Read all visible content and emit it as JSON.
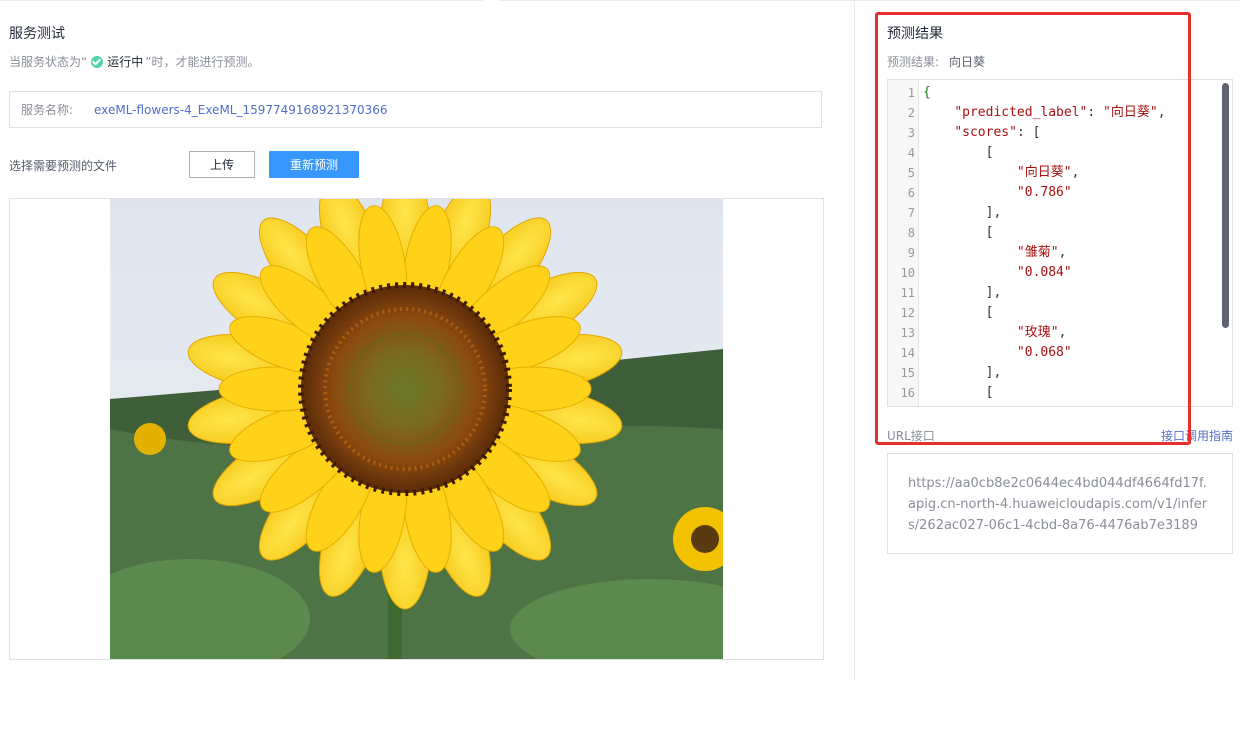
{
  "left": {
    "title": "服务测试",
    "hint_prefix": "当服务状态为“",
    "hint_status": "运行中",
    "hint_suffix": "”时，才能进行预测。",
    "service_label": "服务名称:",
    "service_value": "exeML-flowers-4_ExeML_1597749168921370366",
    "file_label": "选择需要预测的文件",
    "upload_label": "上传",
    "repredict_label": "重新预测",
    "image_icon": "sunflower-photo"
  },
  "right": {
    "title": "预测结果",
    "result_label": "预测结果:",
    "result_value": "向日葵",
    "line_numbers": [
      "1",
      "2",
      "3",
      "4",
      "5",
      "6",
      "7",
      "8",
      "9",
      "10",
      "11",
      "12",
      "13",
      "14",
      "15",
      "16"
    ],
    "code_lines": [
      "{",
      "    \"predicted_label\": \"向日葵\",",
      "    \"scores\": [",
      "        [",
      "            \"向日葵\",",
      "            \"0.786\"",
      "        ],",
      "        [",
      "            \"雏菊\",",
      "            \"0.084\"",
      "        ],",
      "        [",
      "            \"玫瑰\",",
      "            \"0.068\"",
      "        ],",
      "        ["
    ],
    "url_label": "URL接口",
    "url_guide": "接口调用指南",
    "url_value": "https://aa0cb8e2c0644ec4bd044df4664fd17f.apig.cn-north-4.huaweicloudapis.com/v1/infers/262ac027-06c1-4cbd-8a76-4476ab7e3189"
  },
  "colors": {
    "primary": "#3796fb",
    "link": "#526ecc",
    "status_ok": "#50d4ab",
    "highlight": "#e5302c"
  }
}
